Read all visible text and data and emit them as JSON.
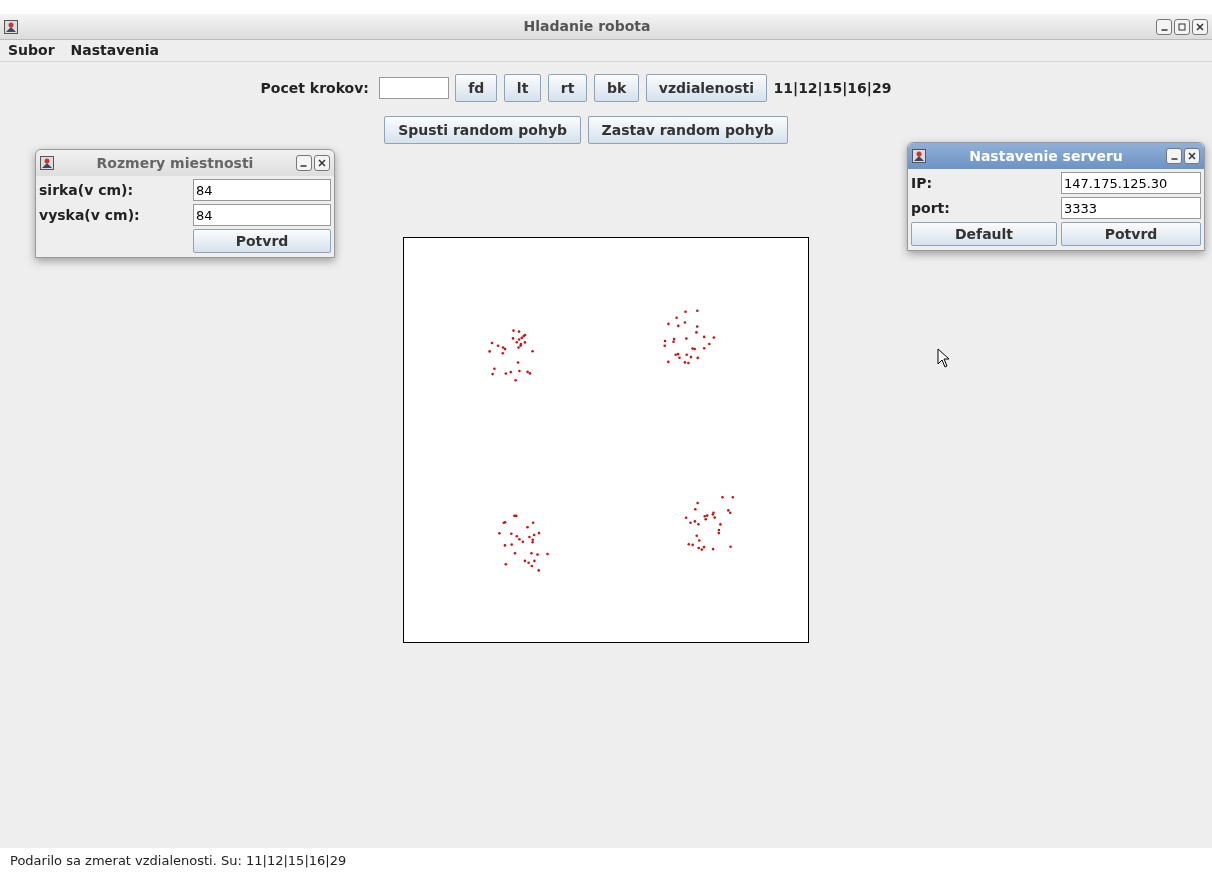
{
  "window": {
    "title": "Hladanie robota"
  },
  "menu": [
    "Subor",
    "Nastavenia"
  ],
  "toolbar": {
    "steps_label": "Pocet krokov:",
    "buttons": [
      "fd",
      "lt",
      "rt",
      "bk",
      "vzdialenosti"
    ],
    "reading": "11|12|15|16|29"
  },
  "random_buttons": [
    "Spusti random pohyb",
    "Zastav random pohyb"
  ],
  "frames": [
    {
      "title": "Rozmery miestnosti",
      "active": false,
      "fields": [
        {
          "label": "sirka(v cm):",
          "value": "84"
        },
        {
          "label": "vyska(v cm):",
          "value": "84"
        }
      ],
      "buttons": [
        "Potvrd"
      ]
    },
    {
      "title": "Nastavenie serveru",
      "active": true,
      "fields": [
        {
          "label": "IP:",
          "value": "147.175.125.30"
        },
        {
          "label": "port:",
          "value": "3333"
        }
      ],
      "buttons": [
        "Default",
        "Potvrd"
      ]
    }
  ],
  "status_bar": "Podarilo sa zmerat vzdialenosti. Su: 11|12|15|16|29"
}
